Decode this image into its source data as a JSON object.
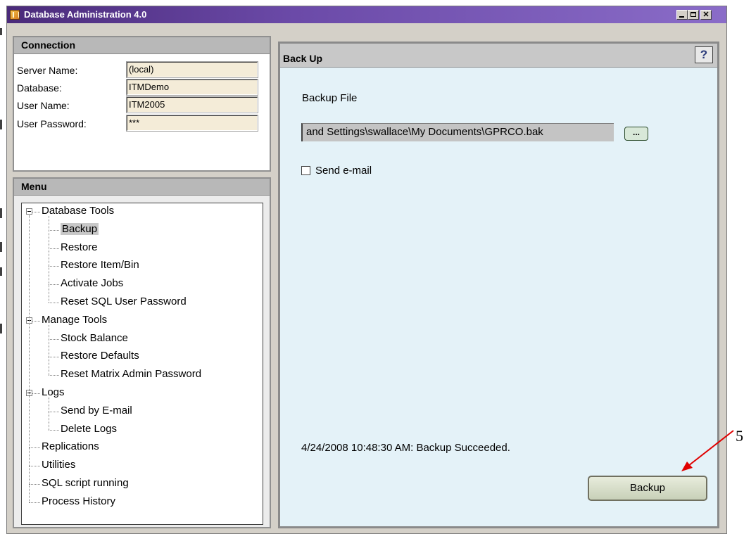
{
  "window": {
    "title": "Database Administration 4.0"
  },
  "connection": {
    "header": "Connection",
    "fields": [
      {
        "label": "Server Name:",
        "value": "(local)"
      },
      {
        "label": "Database:",
        "value": "ITMDemo"
      },
      {
        "label": "User Name:",
        "value": "ITM2005"
      },
      {
        "label": "User Password:",
        "value": "***"
      }
    ]
  },
  "menu": {
    "header": "Menu",
    "items": [
      {
        "label": "Database Tools",
        "level": 0,
        "expandable": true
      },
      {
        "label": "Backup",
        "level": 1,
        "selected": true
      },
      {
        "label": "Restore",
        "level": 1
      },
      {
        "label": "Restore Item/Bin",
        "level": 1
      },
      {
        "label": "Activate Jobs",
        "level": 1
      },
      {
        "label": "Reset SQL User Password",
        "level": 1
      },
      {
        "label": "Manage Tools",
        "level": 0,
        "expandable": true
      },
      {
        "label": "Stock Balance",
        "level": 1
      },
      {
        "label": "Restore Defaults",
        "level": 1
      },
      {
        "label": "Reset Matrix Admin Password",
        "level": 1
      },
      {
        "label": "Logs",
        "level": 0,
        "expandable": true
      },
      {
        "label": "Send by E-mail",
        "level": 1
      },
      {
        "label": "Delete Logs",
        "level": 1
      },
      {
        "label": "Replications",
        "level": 0
      },
      {
        "label": "Utilities",
        "level": 0
      },
      {
        "label": "SQL script running",
        "level": 0
      },
      {
        "label": "Process  History",
        "level": 0
      }
    ]
  },
  "backup_panel": {
    "header": "Back Up",
    "help_icon": "?",
    "file_label": "Backup File",
    "file_value": "and Settings\\swallace\\My Documents\\GPRCO.bak",
    "browse_label": "...",
    "send_email_label": "Send e-mail",
    "send_email_checked": false,
    "status": "4/24/2008 10:48:30 AM: Backup Succeeded.",
    "backup_button": "Backup"
  },
  "annotation": {
    "number": "5",
    "arrow_color": "#e00000"
  }
}
